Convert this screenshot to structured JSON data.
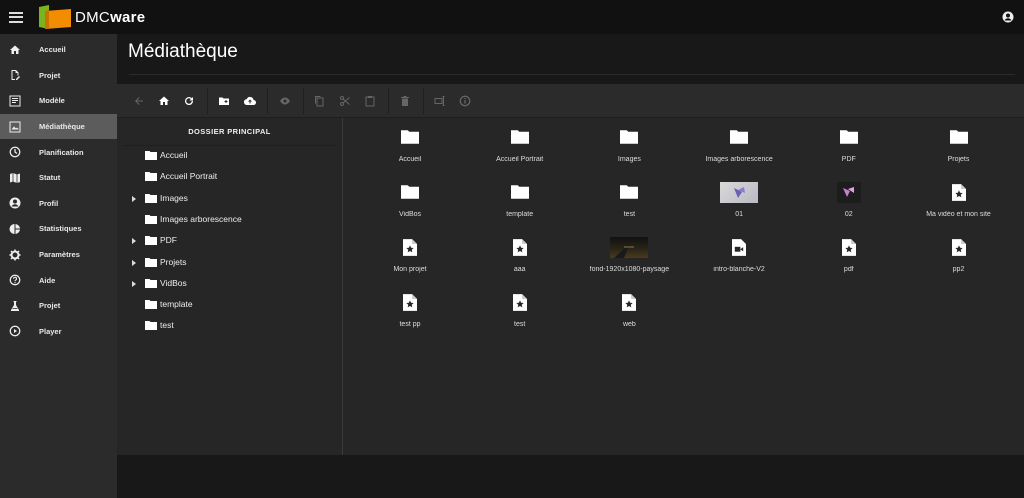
{
  "brand": {
    "prefix": "DMC",
    "suffix": "ware",
    "green": "#7ab51d",
    "orange": "#f28c00"
  },
  "sidebar": {
    "items": [
      {
        "label": "Accueil",
        "icon": "home-icon"
      },
      {
        "label": "Projet",
        "icon": "edit-document-icon"
      },
      {
        "label": "Modèle",
        "icon": "template-icon"
      },
      {
        "label": "Médiathèque",
        "icon": "media-library-icon",
        "active": true
      },
      {
        "label": "Planification",
        "icon": "clock-icon"
      },
      {
        "label": "Statut",
        "icon": "map-icon"
      },
      {
        "label": "Profil",
        "icon": "account-icon"
      },
      {
        "label": "Statistiques",
        "icon": "pie-chart-icon"
      },
      {
        "label": "Paramètres",
        "icon": "gear-icon"
      },
      {
        "label": "Aide",
        "icon": "help-icon"
      },
      {
        "label": "Projet",
        "icon": "flask-icon"
      },
      {
        "label": "Player",
        "icon": "play-circle-icon"
      }
    ]
  },
  "page": {
    "title": "Médiathèque"
  },
  "tree": {
    "header": "DOSSIER PRINCIPAL",
    "items": [
      {
        "label": "Accueil",
        "expandable": false
      },
      {
        "label": "Accueil Portrait",
        "expandable": false
      },
      {
        "label": "Images",
        "expandable": true
      },
      {
        "label": "Images arborescence",
        "expandable": false
      },
      {
        "label": "PDF",
        "expandable": true
      },
      {
        "label": "Projets",
        "expandable": true
      },
      {
        "label": "VidBos",
        "expandable": true
      },
      {
        "label": "template",
        "expandable": false
      },
      {
        "label": "test",
        "expandable": false
      }
    ]
  },
  "files": [
    {
      "label": "Accueil",
      "kind": "folder"
    },
    {
      "label": "Accueil Portrait",
      "kind": "folder"
    },
    {
      "label": "Images",
      "kind": "folder"
    },
    {
      "label": "Images arborescence",
      "kind": "folder"
    },
    {
      "label": "PDF",
      "kind": "folder"
    },
    {
      "label": "Projets",
      "kind": "folder"
    },
    {
      "label": "VidBos",
      "kind": "folder"
    },
    {
      "label": "template",
      "kind": "folder"
    },
    {
      "label": "test",
      "kind": "folder"
    },
    {
      "label": "01",
      "kind": "thumb-light"
    },
    {
      "label": "02",
      "kind": "thumb-dark"
    },
    {
      "label": "Ma vidéo et mon site",
      "kind": "project"
    },
    {
      "label": "Mon projet",
      "kind": "project"
    },
    {
      "label": "aaa",
      "kind": "project"
    },
    {
      "label": "fond-1920x1080-paysage",
      "kind": "thumb-road"
    },
    {
      "label": "intro-blanche-V2",
      "kind": "video"
    },
    {
      "label": "pdf",
      "kind": "project"
    },
    {
      "label": "pp2",
      "kind": "project"
    },
    {
      "label": "test pp",
      "kind": "project"
    },
    {
      "label": "test",
      "kind": "project"
    },
    {
      "label": "web",
      "kind": "project"
    }
  ]
}
